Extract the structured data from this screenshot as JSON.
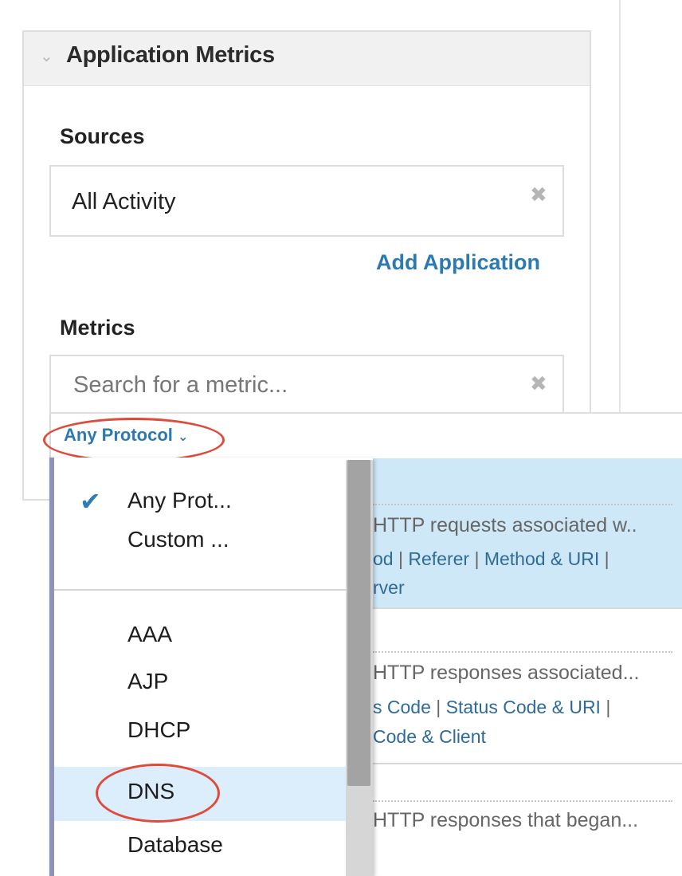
{
  "panel": {
    "title": "Application Metrics"
  },
  "sources": {
    "label": "Sources",
    "value": "All Activity",
    "add_link": "Add Application"
  },
  "metrics": {
    "label": "Metrics",
    "search_placeholder": "Search for a metric...",
    "protocol_filter": "Any Protocol"
  },
  "protocol_menu": {
    "items": [
      {
        "label": "Any Prot...",
        "checked": true
      },
      {
        "label": "Custom ..."
      },
      {
        "label": "AAA"
      },
      {
        "label": "AJP"
      },
      {
        "label": "DHCP"
      },
      {
        "label": "DNS",
        "highlighted": true
      },
      {
        "label": "Database"
      }
    ]
  },
  "results": [
    {
      "description": "HTTP requests associated w..",
      "links_line1": [
        "od",
        "Referer",
        "Method & URI"
      ],
      "links_line2": "rver"
    },
    {
      "description": "HTTP responses associated...",
      "links_line1": [
        "s Code",
        "Status Code & URI"
      ],
      "links_line2": "Code & Client"
    },
    {
      "description": "HTTP responses that began..."
    }
  ],
  "colors": {
    "link": "#2d7ab0",
    "highlight": "#cfe8f8",
    "annotation": "#e04a3a",
    "check": "#2f7cb7"
  }
}
